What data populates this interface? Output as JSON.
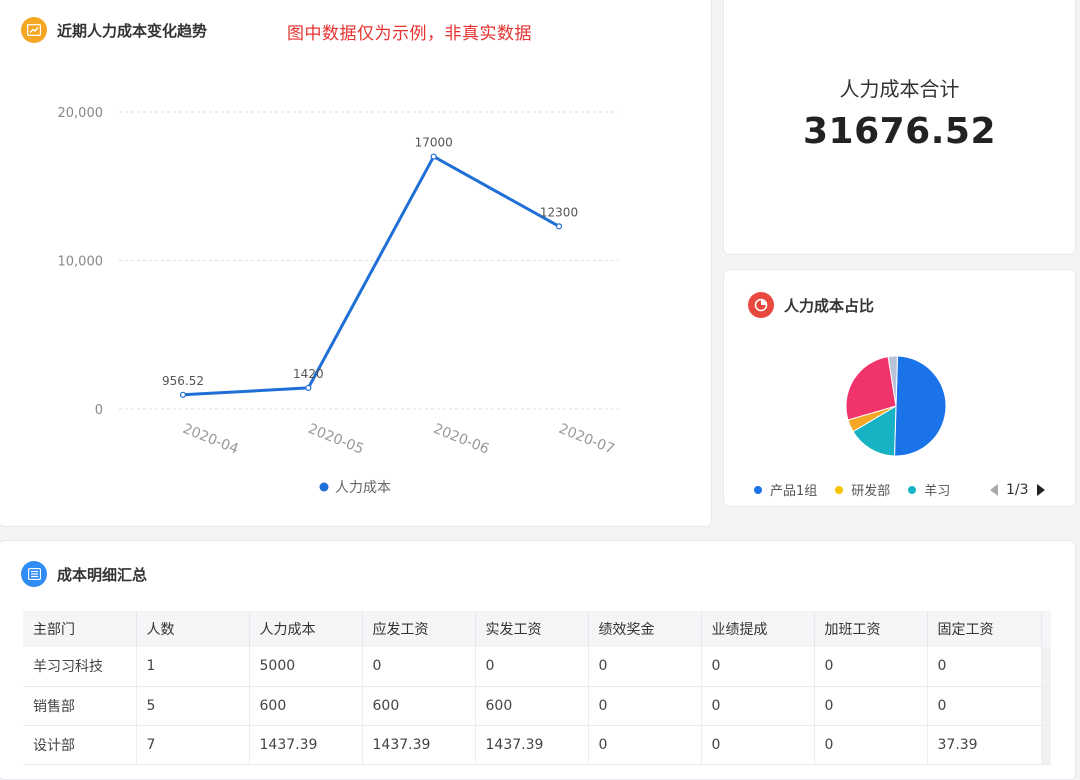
{
  "trend": {
    "title": "近期人力成本变化趋势",
    "disclaimer": "图中数据仅为示例，非真实数据",
    "icon": "trend-chart-icon",
    "accent": "#f5a623"
  },
  "chart_data": {
    "type": "line",
    "categories": [
      "2020-04",
      "2020-05",
      "2020-06",
      "2020-07"
    ],
    "series": [
      {
        "name": "人力成本",
        "values": [
          956.52,
          1420,
          17000,
          12300
        ]
      }
    ],
    "data_labels": [
      "956.52",
      "1420",
      "17000",
      "12300"
    ],
    "y_ticks": [
      "0",
      "10,000",
      "20,000"
    ],
    "ylim": [
      0,
      20000
    ],
    "grid": true,
    "legend_position": "bottom",
    "line_color": "#1f6fd6"
  },
  "total": {
    "label": "人力成本合计",
    "value": "31676.52"
  },
  "pie": {
    "title": "人力成本占比",
    "icon": "pie-chart-icon",
    "accent": "#e9483f",
    "slices": [
      {
        "name": "产品1组",
        "share": 0.55,
        "color": "#1a73e8"
      },
      {
        "name": "研发部",
        "share": 0.0,
        "color": "#f5c400"
      },
      {
        "name": "羊习习",
        "share": 0.0,
        "color": "#17b3c4"
      }
    ],
    "all_slices": [
      {
        "share": 0.5,
        "color": "#1a73e8"
      },
      {
        "share": 0.16,
        "color": "#17b3c4"
      },
      {
        "share": 0.04,
        "color": "#f5a623"
      },
      {
        "share": 0.27,
        "color": "#f0336b"
      },
      {
        "share": 0.03,
        "color": "#b9c2d6"
      }
    ],
    "legend": [
      {
        "label": "产品1组",
        "color": "#1a73e8"
      },
      {
        "label": "研发部",
        "color": "#f5c400"
      },
      {
        "label": "羊习",
        "color": "#17b3c4"
      }
    ],
    "pager": "1/3"
  },
  "detail": {
    "title": "成本明细汇总",
    "icon": "list-icon",
    "columns": [
      "主部门",
      "人数",
      "人力成本",
      "应发工资",
      "实发工资",
      "绩效奖金",
      "业绩提成",
      "加班工资",
      "固定工资"
    ],
    "rows": [
      [
        "羊习习科技",
        "1",
        "5000",
        "0",
        "0",
        "0",
        "0",
        "0",
        "0"
      ],
      [
        "销售部",
        "5",
        "600",
        "600",
        "600",
        "0",
        "0",
        "0",
        "0"
      ],
      [
        "设计部",
        "7",
        "1437.39",
        "1437.39",
        "1437.39",
        "0",
        "0",
        "0",
        "37.39"
      ]
    ]
  }
}
